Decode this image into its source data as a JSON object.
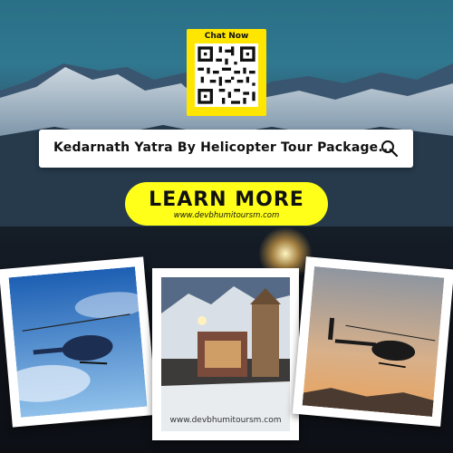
{
  "qr": {
    "title": "Chat Now"
  },
  "search": {
    "text": "Kedarnath Yatra By Helicopter Tour Package..."
  },
  "cta": {
    "label": "LEARN MORE",
    "url": "www.devbhumitoursm.com"
  },
  "photos": {
    "caption_url": "www.devbhumitoursm.com"
  },
  "icons": {
    "search": "search-icon"
  },
  "colors": {
    "accent_yellow": "#ffff1a",
    "qr_yellow": "#ffe600"
  }
}
